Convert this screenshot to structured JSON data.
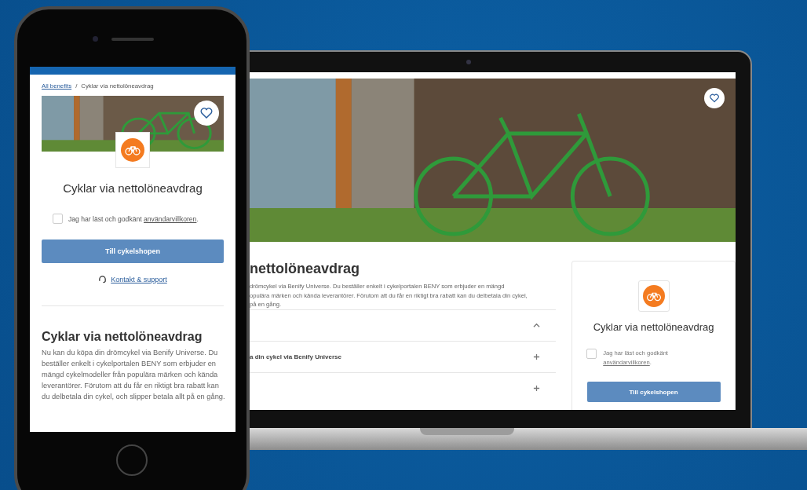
{
  "phone": {
    "breadcrumb": {
      "link": "All benefits",
      "separator": "/",
      "current": "Cyklar via nettolöneavdrag"
    },
    "favorite": {
      "selected": false
    },
    "title": "Cyklar via nettolöneavdrag",
    "terms": {
      "checked": false,
      "text": "Jag har läst och godkänt",
      "link": "användarvillkoren",
      "suffix": "."
    },
    "button": "Till cykelshopen",
    "support_link": "Kontakt & support",
    "section": {
      "heading": "Cyklar via nettolöneavdrag",
      "body": "Nu kan du köpa din drömcykel via Benify Universe. Du beställer enkelt i cykelportalen BENY som erbjuder en mängd cykelmodeller från populära märken och kända leverantörer. Förutom att du får en riktigt bra rabatt kan du delbetala din cykel, och slipper betala allt på en gång."
    }
  },
  "laptop": {
    "favorite": {
      "selected": false
    },
    "title": "nettolöneavdrag",
    "body_lines": [
      "drömcykel via Benify Universe. Du beställer enkelt i cykelportalen BENY som erbjuder en mängd",
      "opulära märken och kända leverantörer. Förutom att du får en riktigt bra rabatt kan du delbetala din cykel,",
      "på en gång."
    ],
    "accordion": [
      {
        "expanded": true
      },
      {
        "label": "a din cykel via Benify Universe",
        "expanded": false
      },
      {
        "expanded": false
      }
    ],
    "card": {
      "title": "Cyklar via nettolöneavdrag",
      "terms": {
        "checked": false,
        "text": "Jag har läst och godkänt",
        "link": "användarvillkoren",
        "suffix": "."
      },
      "button": "Till cykelshopen"
    }
  }
}
